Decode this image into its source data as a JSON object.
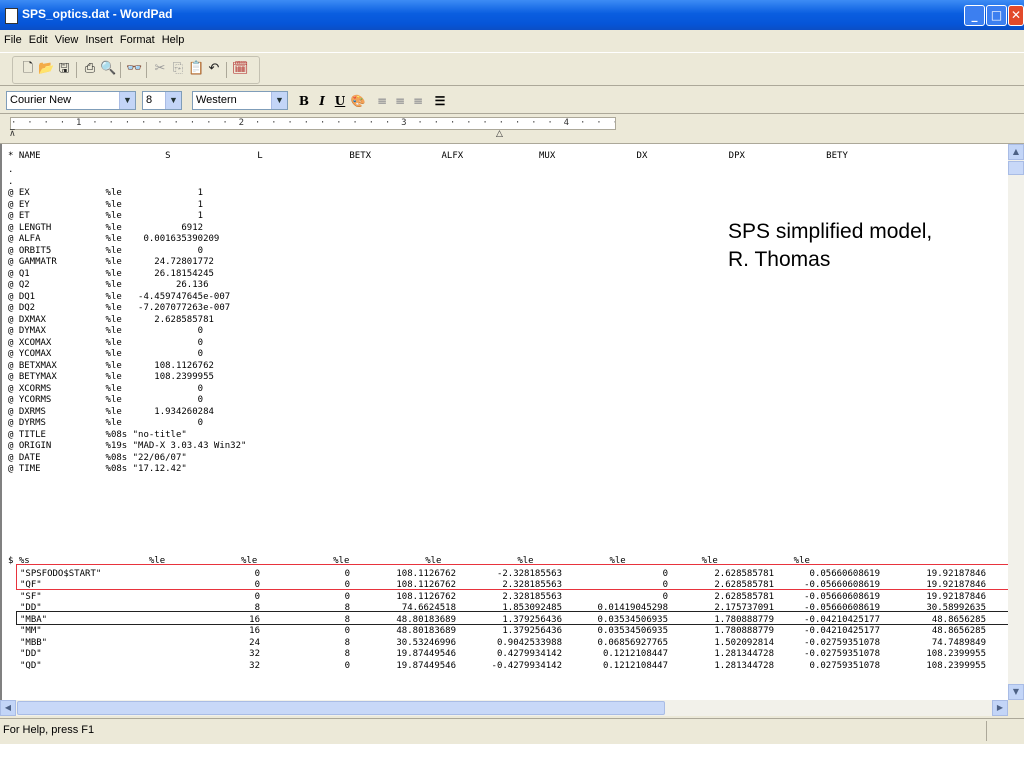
{
  "window": {
    "title": "SPS_optics.dat - WordPad"
  },
  "menu": [
    "File",
    "Edit",
    "View",
    "Insert",
    "Format",
    "Help"
  ],
  "format_bar": {
    "font": "Courier New",
    "size": "8",
    "script": "Western"
  },
  "ruler": {
    "text": "·  ·  ·  ·  1  ·  ·  ·  ·  ·  ·  ·  ·  ·  2  ·  ·  ·  ·  ·  ·  ·  ·  ·  3  ·  ·  ·  ·  ·  ·  ·  ·  ·  4  ·  ·  ·  ·  ·  ·  ·  ·  ·  5  ·  ·  ·  ·  ·  ·  ·  ·  ·  6  ·  ·  ·  ·  ·  ·  ·  ·  ·  7 ·"
  },
  "document": {
    "header_line": "* NAME                       S                L                BETX             ALFX              MUX               DX               DPX               BETY",
    "params_text": ".\n.\n@ EX              %le              1\n@ EY              %le              1\n@ ET              %le              1\n@ LENGTH          %le           6912\n@ ALFA            %le    0.001635390209\n@ ORBIT5          %le              0\n@ GAMMATR         %le      24.72801772\n@ Q1              %le      26.18154245\n@ Q2              %le          26.136\n@ DQ1             %le   -4.459747645e-007\n@ DQ2             %le   -7.207077263e-007\n@ DXMAX           %le      2.628585781\n@ DYMAX           %le              0\n@ XCOMAX          %le              0\n@ YCOMAX          %le              0\n@ BETXMAX         %le      108.1126762\n@ BETYMAX         %le      108.2399955\n@ XCORMS          %le              0\n@ YCORMS          %le              0\n@ DXRMS           %le      1.934260284\n@ DYRMS           %le              0\n@ TITLE           %08s \"no-title\"\n@ ORIGIN          %19s \"MAD-X 3.03.43 Win32\"\n@ DATE            %08s \"22/06/07\"\n@ TIME            %08s \"17.12.42\"",
    "format_line": "$ %s                      %le              %le              %le              %le              %le              %le              %le              %le",
    "rows": [
      [
        "\"SPSFODO$START\"",
        "0",
        "0",
        "108.1126762",
        "-2.328185563",
        "0",
        "2.628585781",
        "0.05660608619",
        "19.92187846"
      ],
      [
        "\"QF\"",
        "0",
        "0",
        "108.1126762",
        "2.328185563",
        "0",
        "2.628585781",
        "-0.05660608619",
        "19.92187846"
      ],
      [
        "\"SF\"",
        "0",
        "0",
        "108.1126762",
        "2.328185563",
        "0",
        "2.628585781",
        "-0.05660608619",
        "19.92187846"
      ],
      [
        "\"DD\"",
        "8",
        "8",
        "74.6624518",
        "1.853092485",
        "0.01419045298",
        "2.175737091",
        "-0.05660608619",
        "30.58992635"
      ],
      [
        "\"MBA\"",
        "16",
        "8",
        "48.80183689",
        "1.379256436",
        "0.03534506935",
        "1.780888779",
        "-0.04210425177",
        "48.8656285"
      ],
      [
        "\"MM\"",
        "16",
        "0",
        "48.80183689",
        "1.379256436",
        "0.03534506935",
        "1.780888779",
        "-0.04210425177",
        "48.8656285"
      ],
      [
        "\"MBB\"",
        "24",
        "8",
        "30.53246996",
        "0.9042533988",
        "0.06856927765",
        "1.502092814",
        "-0.02759351078",
        "74.7489849"
      ],
      [
        "\"DD\"",
        "32",
        "8",
        "19.87449546",
        "0.4279934142",
        "0.1212108447",
        "1.281344728",
        "-0.02759351078",
        "108.2399955"
      ],
      [
        "\"QD\"",
        "32",
        "0",
        "19.87449546",
        "-0.4279934142",
        "0.1212108447",
        "1.281344728",
        "0.02759351078",
        "108.2399955"
      ]
    ]
  },
  "annotation": {
    "line1": "SPS simplified model,",
    "line2": "R. Thomas"
  },
  "status": {
    "text": "For Help, press F1"
  }
}
